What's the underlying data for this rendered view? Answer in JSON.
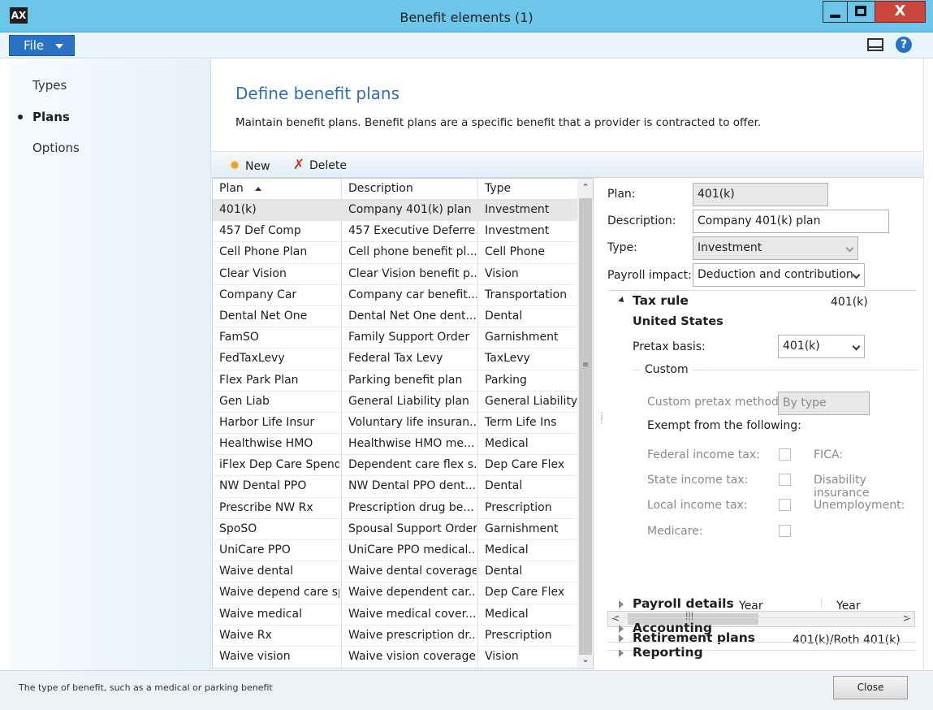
{
  "window": {
    "title": "Benefit elements (1)",
    "close_symbol": "X",
    "app_icon": "AX"
  },
  "ribbon": {
    "file_label": "File",
    "help_symbol": "?"
  },
  "nav": {
    "items": [
      {
        "label": "Types",
        "active": false
      },
      {
        "label": "Plans",
        "active": true
      },
      {
        "label": "Options",
        "active": false
      }
    ]
  },
  "page": {
    "title": "Define benefit plans",
    "description": "Maintain benefit plans. Benefit plans are a specific benefit that a provider is contracted to offer."
  },
  "toolbar": {
    "new_label": "New",
    "delete_label": "Delete"
  },
  "grid": {
    "columns": [
      "Plan",
      "Description",
      "Type"
    ],
    "rows": [
      {
        "plan": "401(k)",
        "description": "Company 401(k) plan",
        "type": "Investment"
      },
      {
        "plan": "457 Def Comp",
        "description": "457 Executive Deferre...",
        "type": "Investment"
      },
      {
        "plan": "Cell Phone Plan",
        "description": "Cell phone benefit pl...",
        "type": "Cell Phone"
      },
      {
        "plan": "Clear Vision",
        "description": "Clear Vision benefit p...",
        "type": "Vision"
      },
      {
        "plan": "Company Car",
        "description": "Company car benefit...",
        "type": "Transportation"
      },
      {
        "plan": "Dental Net One",
        "description": "Dental Net One dent...",
        "type": "Dental"
      },
      {
        "plan": "FamSO",
        "description": "Family Support Order",
        "type": "Garnishment"
      },
      {
        "plan": "FedTaxLevy",
        "description": "Federal Tax Levy",
        "type": "TaxLevy"
      },
      {
        "plan": "Flex Park Plan",
        "description": "Parking benefit plan",
        "type": "Parking"
      },
      {
        "plan": "Gen Liab",
        "description": "General Liability plan",
        "type": "General Liability"
      },
      {
        "plan": "Harbor Life Insur",
        "description": "Voluntary life insuran...",
        "type": "Term Life Ins"
      },
      {
        "plan": "Healthwise HMO",
        "description": "Healthwise HMO me...",
        "type": "Medical"
      },
      {
        "plan": "iFlex Dep Care Spend",
        "description": "Dependent care flex s...",
        "type": "Dep Care Flex"
      },
      {
        "plan": "NW Dental PPO",
        "description": "NW Dental PPO dent...",
        "type": "Dental"
      },
      {
        "plan": "Prescribe NW Rx",
        "description": "Prescription drug be...",
        "type": "Prescription"
      },
      {
        "plan": "SpoSO",
        "description": "Spousal Support Order",
        "type": "Garnishment"
      },
      {
        "plan": "UniCare PPO",
        "description": "UniCare PPO medical...",
        "type": "Medical"
      },
      {
        "plan": "Waive dental",
        "description": "Waive dental coverage",
        "type": "Dental"
      },
      {
        "plan": "Waive depend care sp",
        "description": "Waive dependent car...",
        "type": "Dep Care Flex"
      },
      {
        "plan": "Waive medical",
        "description": "Waive medical cover...",
        "type": "Medical"
      },
      {
        "plan": "Waive Rx",
        "description": "Waive prescription dr...",
        "type": "Prescription"
      },
      {
        "plan": "Waive vision",
        "description": "Waive vision coverage",
        "type": "Vision"
      }
    ]
  },
  "detail": {
    "plan_label": "Plan:",
    "plan_value": "401(k)",
    "description_label": "Description:",
    "description_value": "Company 401(k) plan",
    "type_label": "Type:",
    "type_value": "Investment",
    "payroll_impact_label": "Payroll impact:",
    "payroll_impact_value": "Deduction and contribution",
    "tax_rule": {
      "title": "Tax rule",
      "value": "401(k)",
      "country": "United States",
      "pretax_basis_label": "Pretax basis:",
      "pretax_basis_value": "401(k)",
      "custom_label": "Custom",
      "custom_method_label": "Custom pretax method:",
      "custom_method_value": "By type",
      "exempt_label": "Exempt from the following:",
      "federal_income_tax": "Federal income tax:",
      "fica": "FICA:",
      "state_income_tax": "State income tax:",
      "disability_insurance": "Disability insurance",
      "local_income_tax": "Local income tax:",
      "unemployment": "Unemployment:",
      "medicare": "Medicare:"
    },
    "retirement_plans": {
      "title": "Retirement plans",
      "value": "401(k)/Roth 401(k)"
    },
    "payroll_details": {
      "title": "Payroll details",
      "value1": "Year",
      "value2": "Year"
    },
    "accounting": {
      "title": "Accounting"
    },
    "reporting": {
      "title": "Reporting"
    }
  },
  "status": {
    "text": "The type of benefit, such as a medical or parking benefit",
    "close_label": "Close"
  }
}
